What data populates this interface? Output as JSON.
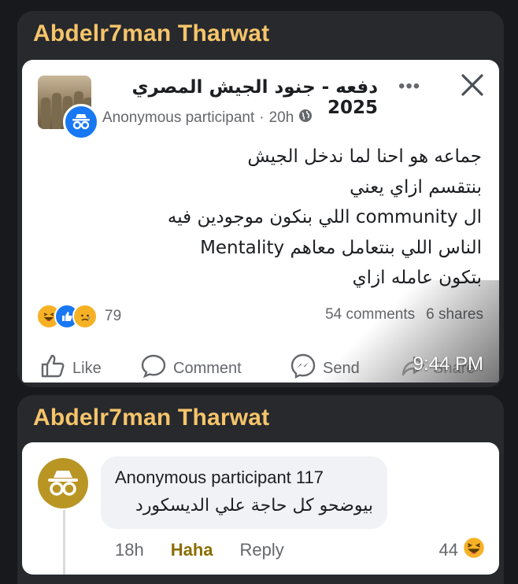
{
  "messages": [
    {
      "sender": "Abdelr7man Tharwat",
      "post": {
        "group_name": "دفعه - جنود الجيش المصري 2025",
        "author": "Anonymous participant",
        "separator": "·",
        "age": "20h",
        "privacy_icon": "globe-icon",
        "more_icon": "•••",
        "body_lines": [
          "جماعه هو احنا لما ندخل الجيش",
          "بنتقسم ازاي يعني",
          "ال community اللي بنكون موجودين فيه",
          "الناس اللي بنتعامل معاهم  Mentality",
          "بتكون عامله ازاي"
        ],
        "reaction_icons": [
          "haha-icon",
          "like-icon",
          "sad-icon"
        ],
        "reaction_count": "79",
        "comments": "54 comments",
        "shares": "6 shares",
        "actions": {
          "like": "Like",
          "comment": "Comment",
          "send": "Send",
          "share": "Share"
        }
      },
      "time": "9:44 PM"
    },
    {
      "sender": "Abdelr7man Tharwat",
      "comment": {
        "author": "Anonymous participant 117",
        "text": "بيوضحو كل حاجة علي الديسكورد",
        "age": "18h",
        "reaction_label": "Haha",
        "reply_label": "Reply",
        "reaction_count": "44",
        "reaction_icon": "haha-icon"
      }
    }
  ],
  "colors": {
    "background": "#17191d",
    "bubble": "#27292d",
    "sender": "#f6c46a",
    "facebook_blue": "#1877f2",
    "haha_text": "#8a6d00",
    "anon_avatar": "#b99524"
  }
}
